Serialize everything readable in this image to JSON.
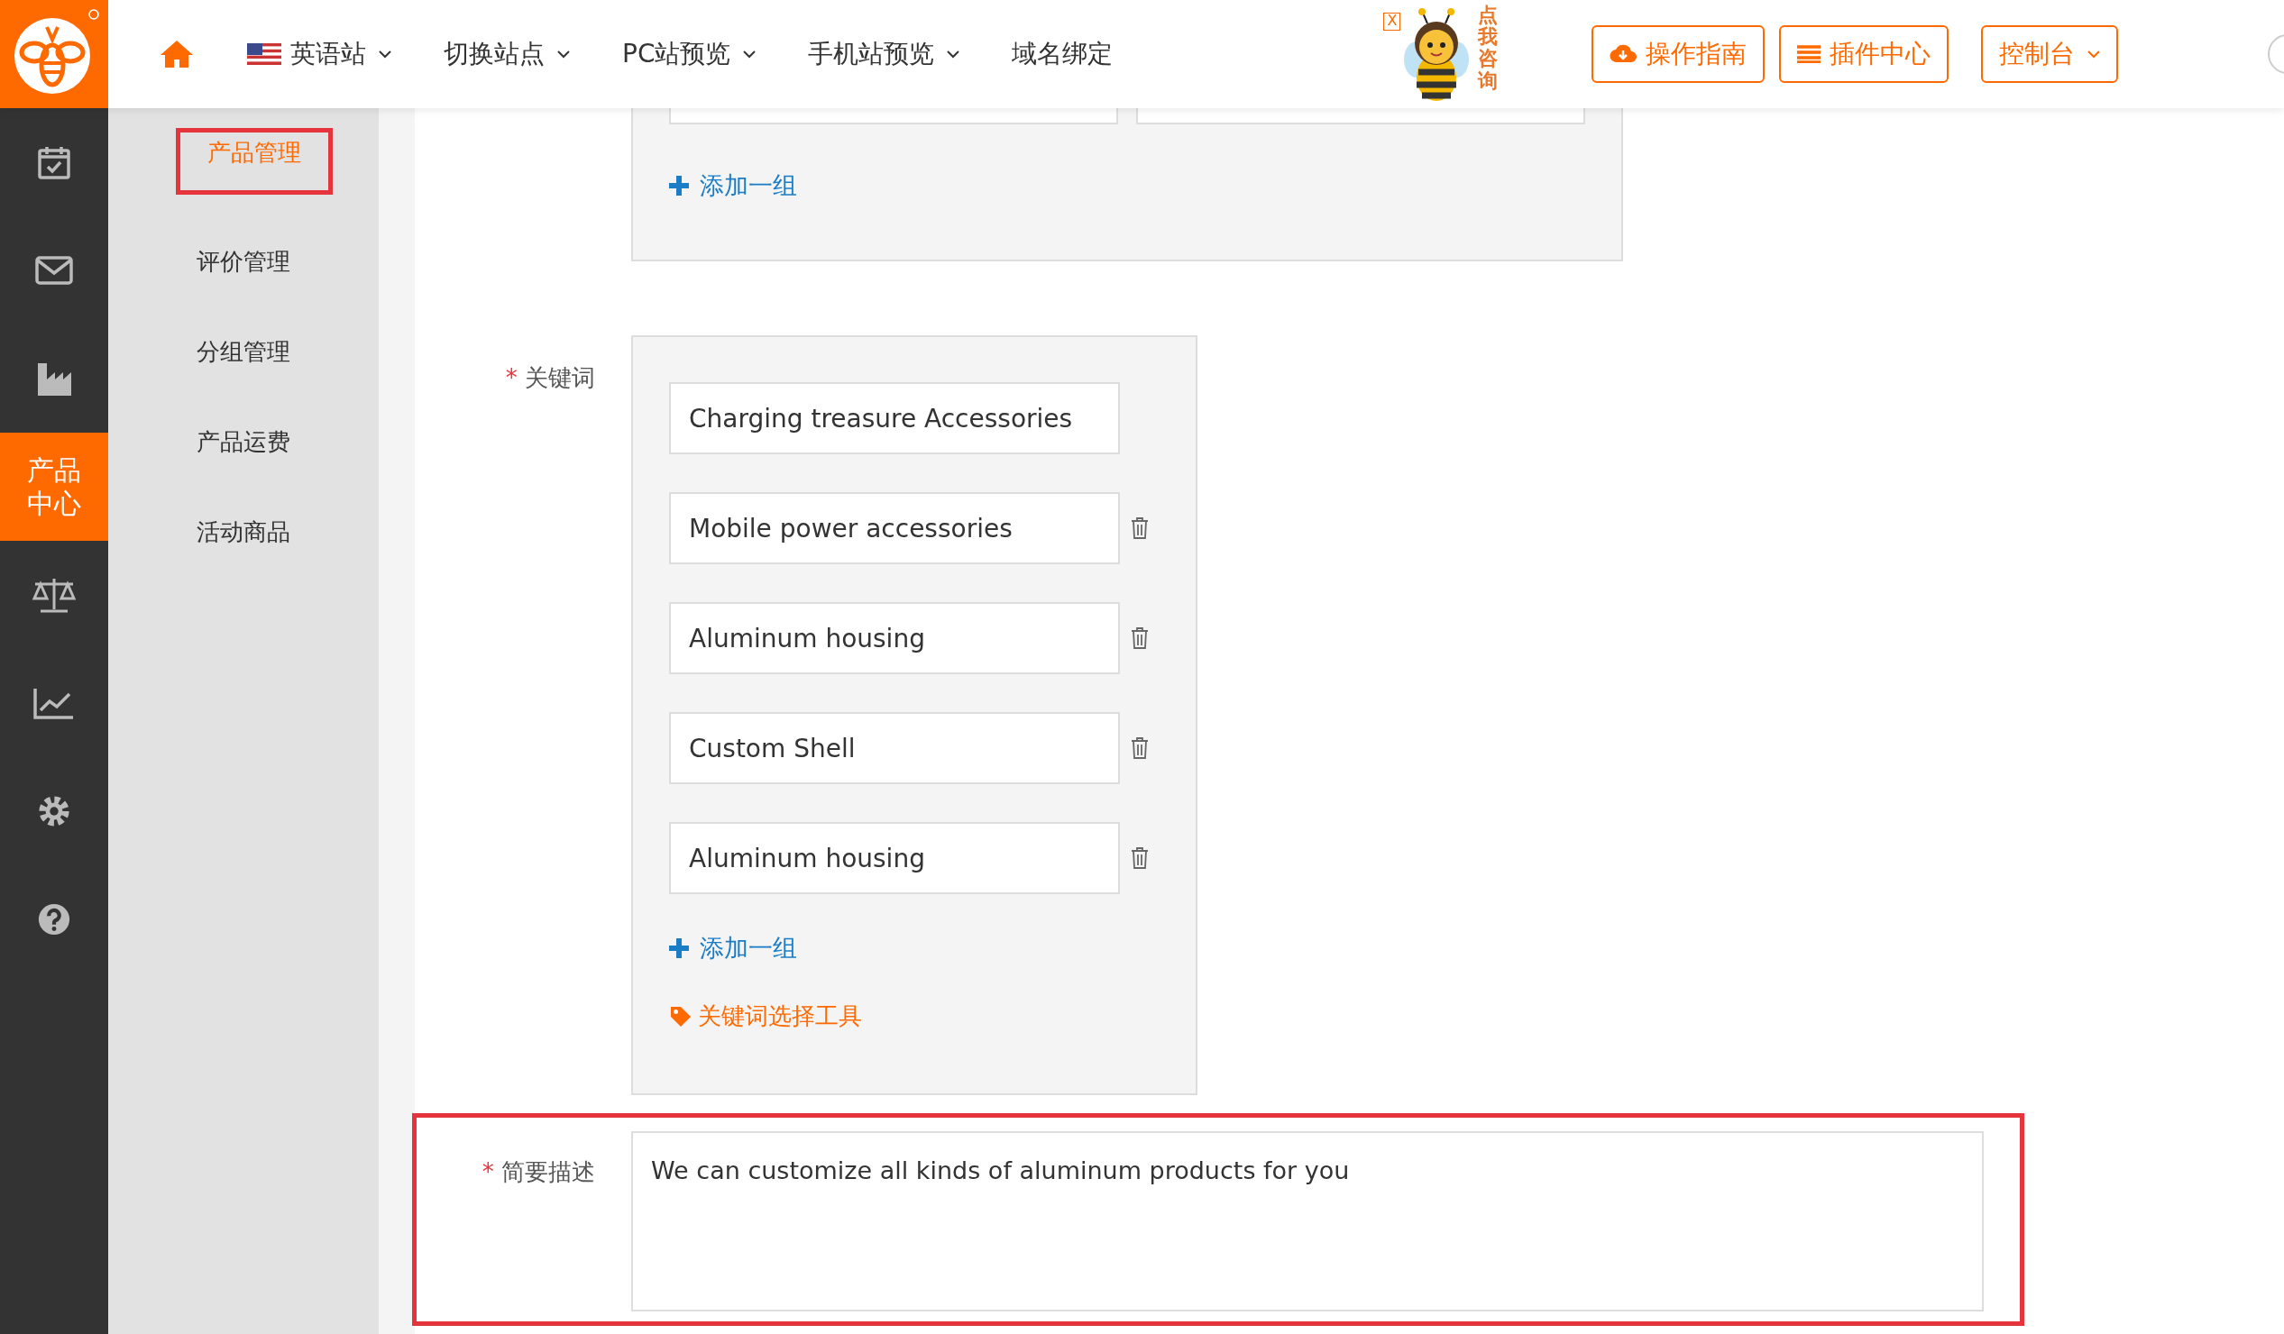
{
  "header": {
    "nav": [
      {
        "kind": "home"
      },
      {
        "kind": "flag",
        "label": "英语站",
        "dropdown": true
      },
      {
        "kind": "text",
        "label": "切换站点",
        "dropdown": true
      },
      {
        "kind": "text",
        "label": "PC站预览",
        "dropdown": true
      },
      {
        "kind": "text",
        "label": "手机站预览",
        "dropdown": true
      },
      {
        "kind": "text",
        "label": "域名绑定",
        "dropdown": false
      }
    ],
    "mascot": {
      "close": "X",
      "text": "点我咨询"
    },
    "actions": [
      {
        "kind": "cloud",
        "label": "操作指南",
        "dropdown": false
      },
      {
        "kind": "list",
        "label": "插件中心",
        "dropdown": false
      },
      {
        "kind": "none",
        "label": "控制台",
        "dropdown": true
      }
    ]
  },
  "rail": [
    {
      "kind": "calendar",
      "selected": false
    },
    {
      "kind": "mail",
      "selected": false
    },
    {
      "kind": "factory",
      "selected": false
    },
    {
      "kind": "label",
      "label": "产品中心",
      "selected": true
    },
    {
      "kind": "scale",
      "selected": false
    },
    {
      "kind": "chart",
      "selected": false
    },
    {
      "kind": "gear",
      "selected": false
    },
    {
      "kind": "help",
      "selected": false
    }
  ],
  "submenu": [
    {
      "label": "产品管理",
      "selected": true,
      "annotated": true
    },
    {
      "label": "评价管理",
      "selected": false,
      "annotated": false
    },
    {
      "label": "分组管理",
      "selected": false,
      "annotated": false
    },
    {
      "label": "产品运费",
      "selected": false,
      "annotated": false
    },
    {
      "label": "活动商品",
      "selected": false,
      "annotated": false
    }
  ],
  "form": {
    "group_box": {
      "add_link": "添加一组"
    },
    "keywords": {
      "label": "关键词",
      "required_mark": "*",
      "items": [
        {
          "value": "Charging treasure Accessories",
          "deletable": false
        },
        {
          "value": "Mobile power accessories",
          "deletable": true
        },
        {
          "value": "Aluminum housing",
          "deletable": true
        },
        {
          "value": "Custom Shell",
          "deletable": true
        },
        {
          "value": "Aluminum housing",
          "deletable": true
        }
      ],
      "add_link": "添加一组",
      "tool_link": "关键词选择工具"
    },
    "description": {
      "label": "简要描述",
      "required_mark": "*",
      "annotated": true,
      "value": "We can customize all kinds of aluminum products for you"
    }
  }
}
